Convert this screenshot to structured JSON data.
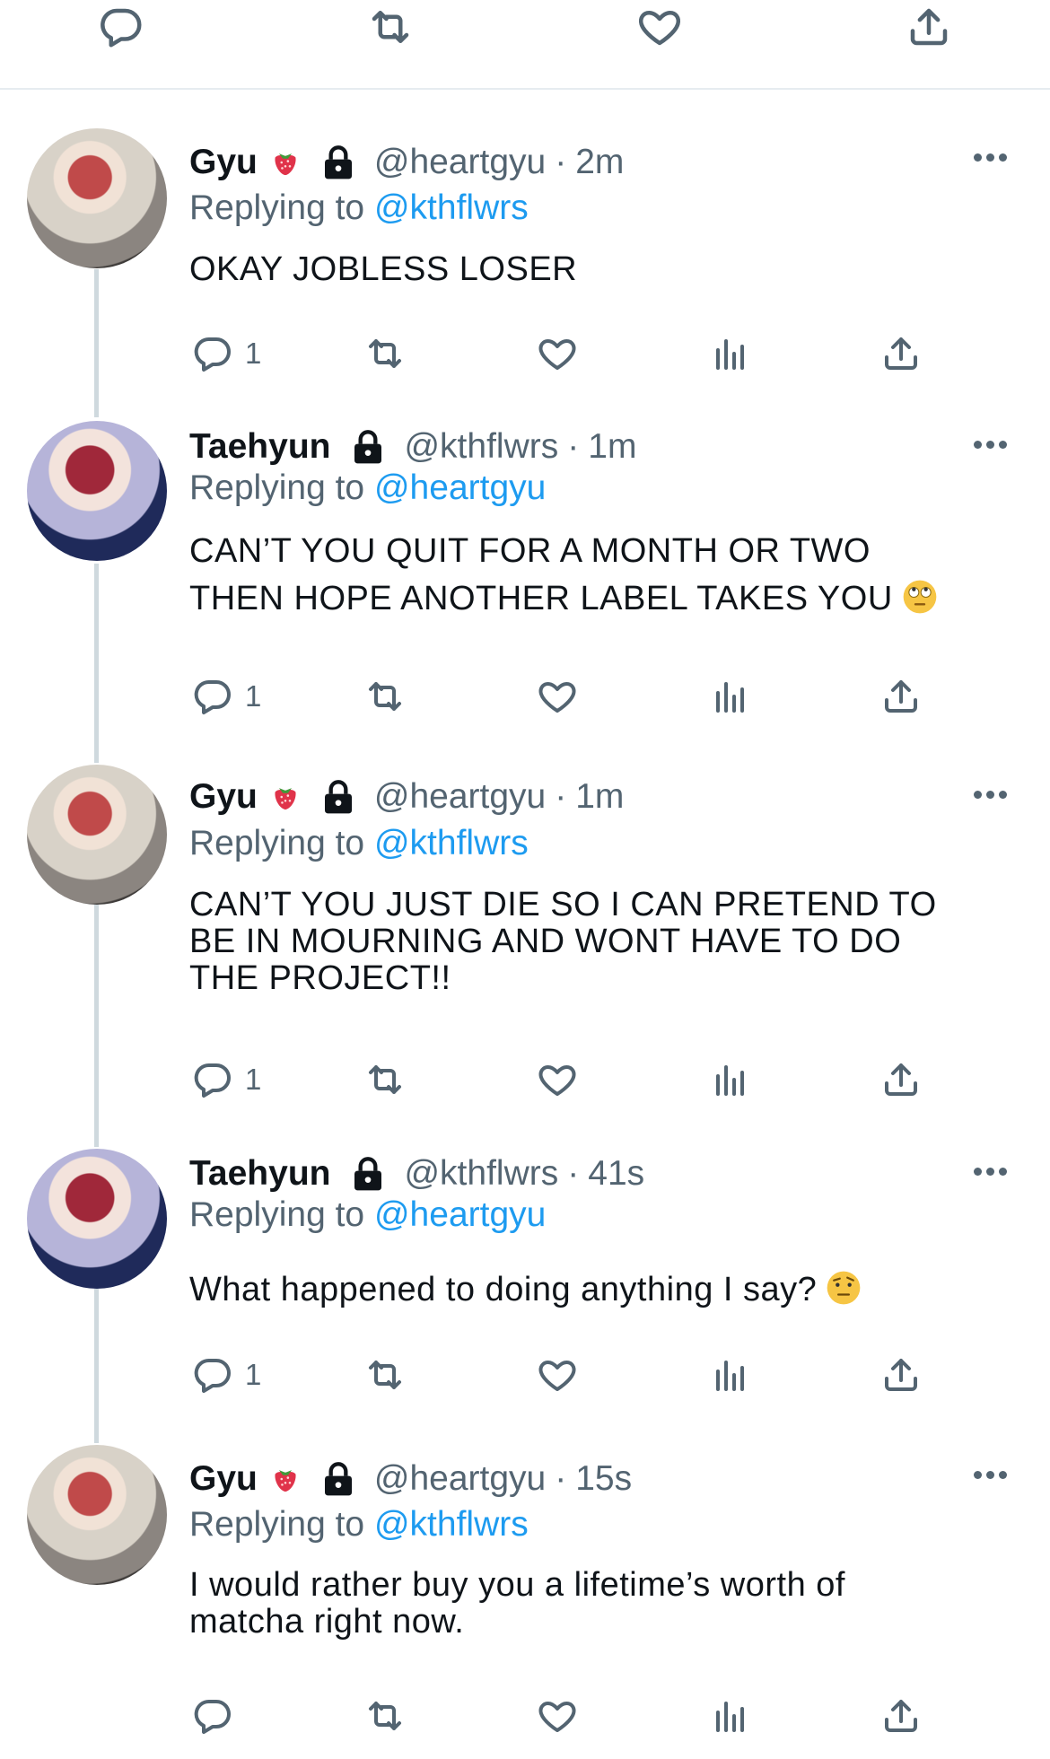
{
  "top_actions": {
    "reply_icon": "reply-icon",
    "retweet_icon": "retweet-icon",
    "like_icon": "heart-icon",
    "share_icon": "share-icon"
  },
  "replying_to_label": "Replying to",
  "colors": {
    "link": "#1d9bf0",
    "secondary": "#536471",
    "thread_line": "#cfd9de"
  },
  "tweets": [
    {
      "name": "Gyu",
      "name_emoji": "strawberry",
      "locked": true,
      "handle": "@heartgyu",
      "sep": "·",
      "time": "2m",
      "replying_to": "@kthflwrs",
      "text_lines": [
        "OKAY JOBLESS LOSER"
      ],
      "reply_count": "1"
    },
    {
      "name": "Taehyun",
      "locked": true,
      "handle": "@kthflwrs",
      "sep": "·",
      "time": "1m",
      "replying_to": "@heartgyu",
      "text_lines": [
        "CAN’T YOU QUIT FOR A MONTH OR TWO",
        "THEN HOPE ANOTHER LABEL TAKES YOU"
      ],
      "text_emoji": "face-with-rolling-eyes",
      "reply_count": "1"
    },
    {
      "name": "Gyu",
      "name_emoji": "strawberry",
      "locked": true,
      "handle": "@heartgyu",
      "sep": "·",
      "time": "1m",
      "replying_to": "@kthflwrs",
      "text_lines": [
        "CAN’T YOU JUST DIE SO I CAN PRETEND TO",
        "BE IN MOURNING AND WONT HAVE TO DO",
        "THE PROJECT!!"
      ],
      "reply_count": "1"
    },
    {
      "name": "Taehyun",
      "locked": true,
      "handle": "@kthflwrs",
      "sep": "·",
      "time": "41s",
      "replying_to": "@heartgyu",
      "text_lines": [
        "What happened to doing anything I say?"
      ],
      "text_emoji": "face-with-raised-eyebrow",
      "reply_count": "1"
    },
    {
      "name": "Gyu",
      "name_emoji": "strawberry",
      "locked": true,
      "handle": "@heartgyu",
      "sep": "·",
      "time": "15s",
      "replying_to": "@kthflwrs",
      "text_lines": [
        "I would rather buy you a lifetime’s worth of",
        "matcha right now."
      ],
      "reply_count": ""
    }
  ]
}
